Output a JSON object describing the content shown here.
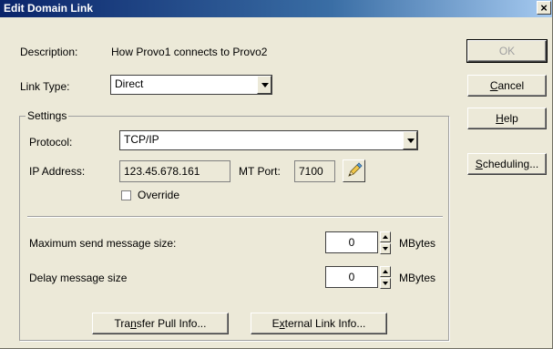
{
  "window": {
    "title": "Edit Domain Link",
    "close_glyph": "×"
  },
  "description": {
    "label": "Description:",
    "value": "How Provo1 connects to Provo2"
  },
  "link_type": {
    "label": "Link Type:",
    "value": "Direct"
  },
  "settings": {
    "legend": "Settings",
    "protocol": {
      "label": "Protocol:",
      "value": "TCP/IP"
    },
    "ip_address": {
      "label": "IP Address:",
      "value": "123.45.678.161"
    },
    "mt_port": {
      "label": "MT Port:",
      "value": "7100"
    },
    "edit_icon": "pencil-icon",
    "override": {
      "label": "Override",
      "checked": false
    },
    "max_send": {
      "label": "Maximum send message size:",
      "value": "0",
      "unit": "MBytes"
    },
    "delay": {
      "label": "Delay message size",
      "value": "0",
      "unit": "MBytes"
    }
  },
  "buttons": {
    "ok": "OK",
    "cancel_pre": "",
    "cancel_u": "C",
    "cancel_post": "ancel",
    "help_pre": "",
    "help_u": "H",
    "help_post": "elp",
    "scheduling_pre": "",
    "scheduling_u": "S",
    "scheduling_post": "cheduling...",
    "transfer_pre": "Tra",
    "transfer_u": "n",
    "transfer_post": "sfer Pull Info...",
    "external_pre": "E",
    "external_u": "x",
    "external_post": "ternal Link Info..."
  },
  "colors": {
    "title_start": "#0a246a",
    "title_end": "#a6caf0",
    "face": "#ece9d8"
  }
}
